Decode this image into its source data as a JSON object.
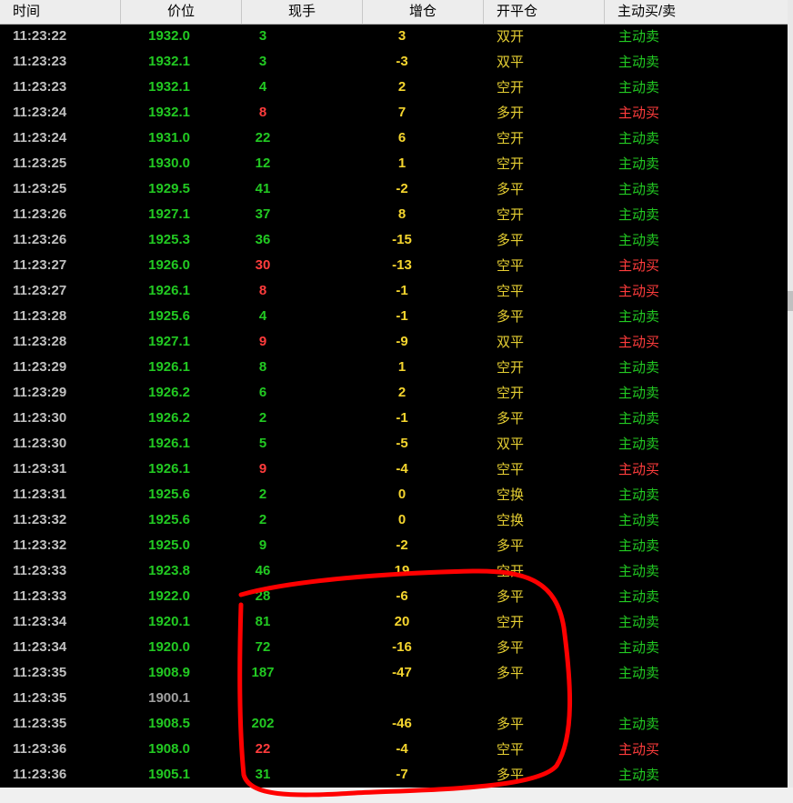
{
  "columns": [
    "时间",
    "价位",
    "现手",
    "增仓",
    "开平仓",
    "主动买/卖"
  ],
  "rows": [
    {
      "time": "11:23:22",
      "price": "1932.0",
      "vol": "3",
      "vol_color": "green",
      "oi": "3",
      "type": "双开",
      "side": "主动卖",
      "side_color": "green"
    },
    {
      "time": "11:23:23",
      "price": "1932.1",
      "vol": "3",
      "vol_color": "green",
      "oi": "-3",
      "type": "双平",
      "side": "主动卖",
      "side_color": "green"
    },
    {
      "time": "11:23:23",
      "price": "1932.1",
      "vol": "4",
      "vol_color": "green",
      "oi": "2",
      "type": "空开",
      "side": "主动卖",
      "side_color": "green"
    },
    {
      "time": "11:23:24",
      "price": "1932.1",
      "vol": "8",
      "vol_color": "red",
      "oi": "7",
      "type": "多开",
      "side": "主动买",
      "side_color": "red"
    },
    {
      "time": "11:23:24",
      "price": "1931.0",
      "vol": "22",
      "vol_color": "green",
      "oi": "6",
      "type": "空开",
      "side": "主动卖",
      "side_color": "green"
    },
    {
      "time": "11:23:25",
      "price": "1930.0",
      "vol": "12",
      "vol_color": "green",
      "oi": "1",
      "type": "空开",
      "side": "主动卖",
      "side_color": "green"
    },
    {
      "time": "11:23:25",
      "price": "1929.5",
      "vol": "41",
      "vol_color": "green",
      "oi": "-2",
      "type": "多平",
      "side": "主动卖",
      "side_color": "green"
    },
    {
      "time": "11:23:26",
      "price": "1927.1",
      "vol": "37",
      "vol_color": "green",
      "oi": "8",
      "type": "空开",
      "side": "主动卖",
      "side_color": "green"
    },
    {
      "time": "11:23:26",
      "price": "1925.3",
      "vol": "36",
      "vol_color": "green",
      "oi": "-15",
      "type": "多平",
      "side": "主动卖",
      "side_color": "green"
    },
    {
      "time": "11:23:27",
      "price": "1926.0",
      "vol": "30",
      "vol_color": "red",
      "oi": "-13",
      "type": "空平",
      "side": "主动买",
      "side_color": "red"
    },
    {
      "time": "11:23:27",
      "price": "1926.1",
      "vol": "8",
      "vol_color": "red",
      "oi": "-1",
      "type": "空平",
      "side": "主动买",
      "side_color": "red"
    },
    {
      "time": "11:23:28",
      "price": "1925.6",
      "vol": "4",
      "vol_color": "green",
      "oi": "-1",
      "type": "多平",
      "side": "主动卖",
      "side_color": "green"
    },
    {
      "time": "11:23:28",
      "price": "1927.1",
      "vol": "9",
      "vol_color": "red",
      "oi": "-9",
      "type": "双平",
      "side": "主动买",
      "side_color": "red"
    },
    {
      "time": "11:23:29",
      "price": "1926.1",
      "vol": "8",
      "vol_color": "green",
      "oi": "1",
      "type": "空开",
      "side": "主动卖",
      "side_color": "green"
    },
    {
      "time": "11:23:29",
      "price": "1926.2",
      "vol": "6",
      "vol_color": "green",
      "oi": "2",
      "type": "空开",
      "side": "主动卖",
      "side_color": "green"
    },
    {
      "time": "11:23:30",
      "price": "1926.2",
      "vol": "2",
      "vol_color": "green",
      "oi": "-1",
      "type": "多平",
      "side": "主动卖",
      "side_color": "green"
    },
    {
      "time": "11:23:30",
      "price": "1926.1",
      "vol": "5",
      "vol_color": "green",
      "oi": "-5",
      "type": "双平",
      "side": "主动卖",
      "side_color": "green"
    },
    {
      "time": "11:23:31",
      "price": "1926.1",
      "vol": "9",
      "vol_color": "red",
      "oi": "-4",
      "type": "空平",
      "side": "主动买",
      "side_color": "red"
    },
    {
      "time": "11:23:31",
      "price": "1925.6",
      "vol": "2",
      "vol_color": "green",
      "oi": "0",
      "type": "空换",
      "side": "主动卖",
      "side_color": "green"
    },
    {
      "time": "11:23:32",
      "price": "1925.6",
      "vol": "2",
      "vol_color": "green",
      "oi": "0",
      "type": "空换",
      "side": "主动卖",
      "side_color": "green"
    },
    {
      "time": "11:23:32",
      "price": "1925.0",
      "vol": "9",
      "vol_color": "green",
      "oi": "-2",
      "type": "多平",
      "side": "主动卖",
      "side_color": "green"
    },
    {
      "time": "11:23:33",
      "price": "1923.8",
      "vol": "46",
      "vol_color": "green",
      "oi": "19",
      "type": "空开",
      "side": "主动卖",
      "side_color": "green"
    },
    {
      "time": "11:23:33",
      "price": "1922.0",
      "vol": "28",
      "vol_color": "green",
      "oi": "-6",
      "type": "多平",
      "side": "主动卖",
      "side_color": "green"
    },
    {
      "time": "11:23:34",
      "price": "1920.1",
      "vol": "81",
      "vol_color": "green",
      "oi": "20",
      "type": "空开",
      "side": "主动卖",
      "side_color": "green"
    },
    {
      "time": "11:23:34",
      "price": "1920.0",
      "vol": "72",
      "vol_color": "green",
      "oi": "-16",
      "type": "多平",
      "side": "主动卖",
      "side_color": "green"
    },
    {
      "time": "11:23:35",
      "price": "1908.9",
      "vol": "187",
      "vol_color": "green",
      "oi": "-47",
      "type": "多平",
      "side": "主动卖",
      "side_color": "green"
    },
    {
      "time": "11:23:35",
      "price": "1900.1",
      "price_color": "gray",
      "vol": "",
      "vol_color": "green",
      "oi": "",
      "type": "",
      "side": "",
      "side_color": "green"
    },
    {
      "time": "11:23:35",
      "price": "1908.5",
      "vol": "202",
      "vol_color": "green",
      "oi": "-46",
      "type": "多平",
      "side": "主动卖",
      "side_color": "green"
    },
    {
      "time": "11:23:36",
      "price": "1908.0",
      "vol": "22",
      "vol_color": "red",
      "oi": "-4",
      "type": "空平",
      "side": "主动买",
      "side_color": "red"
    },
    {
      "time": "11:23:36",
      "price": "1905.1",
      "vol": "31",
      "vol_color": "green",
      "oi": "-7",
      "type": "多平",
      "side": "主动卖",
      "side_color": "green"
    }
  ],
  "colors": {
    "green": "#22c922",
    "red": "#ff3c3c",
    "yellow": "#f5d52e",
    "time": "#c0c0c0",
    "annotation": "#ff0000"
  }
}
